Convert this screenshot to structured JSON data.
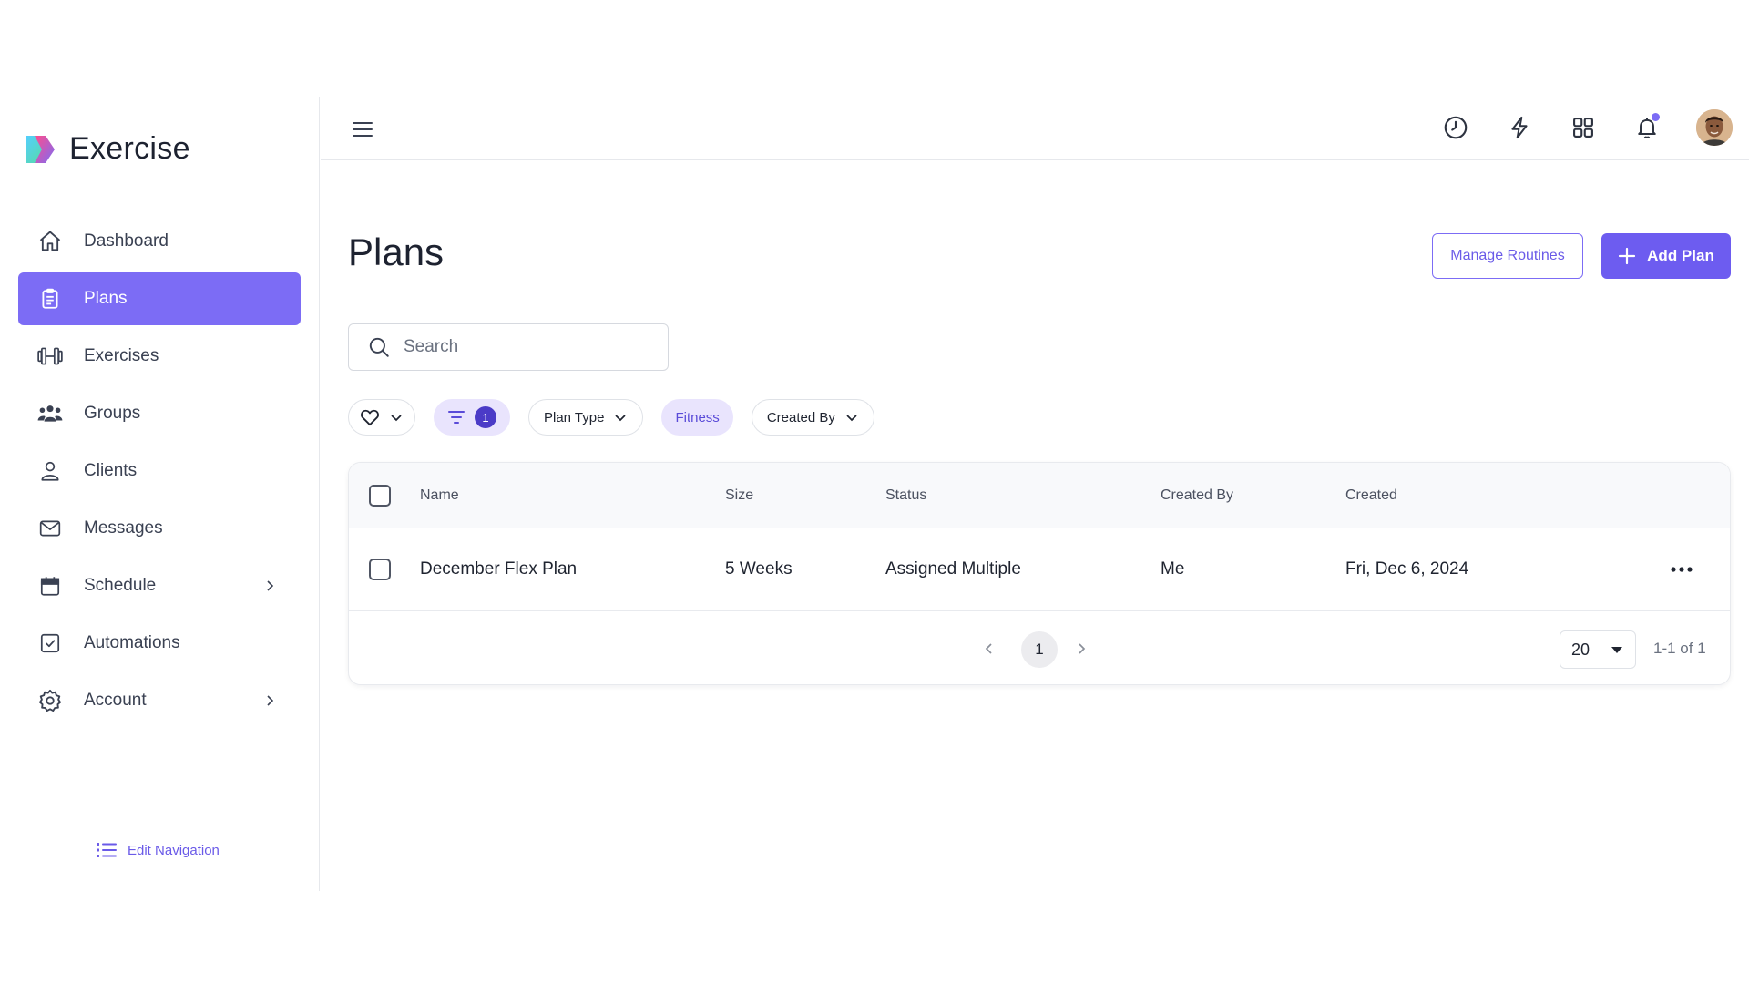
{
  "app": {
    "name": "Exercise"
  },
  "sidebar": {
    "items": [
      {
        "label": "Dashboard",
        "icon": "home-icon",
        "active": false
      },
      {
        "label": "Plans",
        "icon": "clipboard-icon",
        "active": true
      },
      {
        "label": "Exercises",
        "icon": "dumbbell-icon",
        "active": false
      },
      {
        "label": "Groups",
        "icon": "users-icon",
        "active": false
      },
      {
        "label": "Clients",
        "icon": "user-icon",
        "active": false
      },
      {
        "label": "Messages",
        "icon": "mail-icon",
        "active": false
      },
      {
        "label": "Schedule",
        "icon": "calendar-icon",
        "active": false,
        "expandable": true
      },
      {
        "label": "Automations",
        "icon": "check-square-icon",
        "active": false
      },
      {
        "label": "Account",
        "icon": "gear-icon",
        "active": false,
        "expandable": true
      }
    ],
    "edit_navigation_label": "Edit Navigation"
  },
  "topbar": {
    "icons": [
      "menu-icon",
      "clock-icon",
      "lightning-icon",
      "grid-icon",
      "bell-icon",
      "avatar"
    ],
    "has_notification": true
  },
  "main": {
    "title": "Plans",
    "manage_routines_label": "Manage Routines",
    "add_plan_label": "Add Plan",
    "search": {
      "placeholder": "Search",
      "value": ""
    },
    "filters": {
      "active_filter_count": "1",
      "plan_type_label": "Plan Type",
      "fitness_label": "Fitness",
      "created_by_label": "Created By"
    },
    "table": {
      "columns": [
        "Name",
        "Size",
        "Status",
        "Created By",
        "Created"
      ],
      "rows": [
        {
          "name": "December Flex Plan",
          "size": "5 Weeks",
          "status": "Assigned Multiple",
          "created_by": "Me",
          "created": "Fri, Dec 6, 2024"
        }
      ]
    },
    "pagination": {
      "current_page": "1",
      "per_page": "20",
      "range": "1-1 of 1"
    }
  },
  "colors": {
    "accent": "#7c6cf5",
    "accent_dark": "#6d5cf0",
    "lavender": "#e9e4fd",
    "badge": "#4b3bc7"
  }
}
